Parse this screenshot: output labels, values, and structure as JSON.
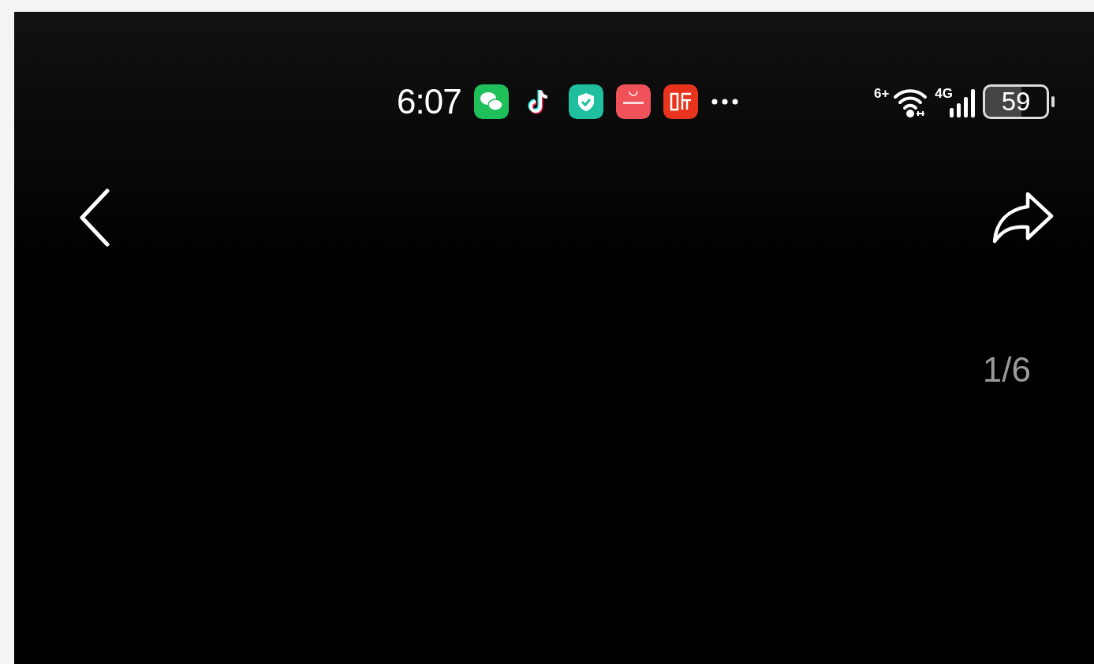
{
  "status_bar": {
    "time": "6:07",
    "wifi_badge": "6+",
    "network_type": "4G",
    "battery": "59"
  },
  "page_counter": "1/6"
}
